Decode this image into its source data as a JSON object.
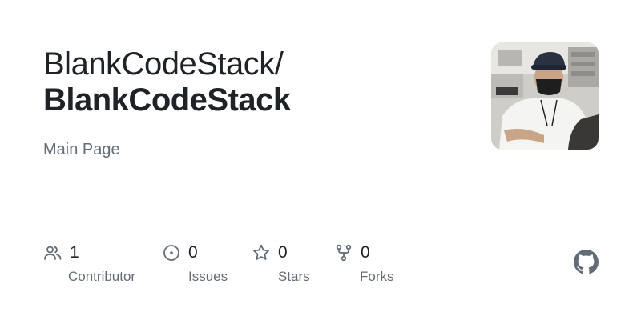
{
  "repo": {
    "owner": "BlankCodeStack/",
    "name": "BlankCodeStack",
    "description": "Main Page"
  },
  "avatar": {
    "alt": "avatar-photo"
  },
  "stats": [
    {
      "icon": "people-icon",
      "value": "1",
      "label": "Contributor"
    },
    {
      "icon": "issue-icon",
      "value": "0",
      "label": "Issues"
    },
    {
      "icon": "star-icon",
      "value": "0",
      "label": "Stars"
    },
    {
      "icon": "fork-icon",
      "value": "0",
      "label": "Forks"
    }
  ],
  "brand": {
    "icon": "github-icon",
    "color": "#636c76"
  }
}
